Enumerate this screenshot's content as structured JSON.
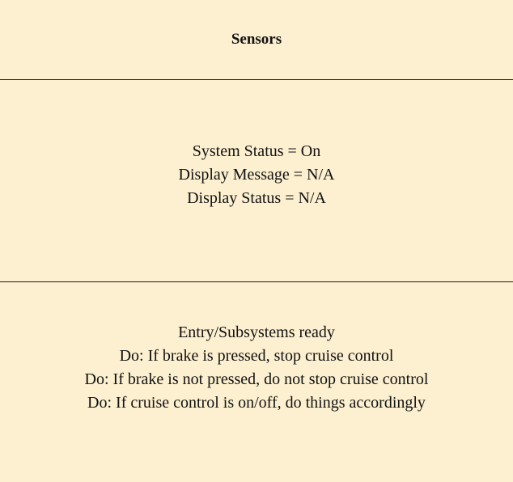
{
  "state": {
    "name": "Sensors",
    "attributes": [
      "System Status = On",
      "Display Message = N/A",
      "Display Status = N/A"
    ],
    "activities": [
      "Entry/Subsystems ready",
      "Do: If brake is pressed, stop cruise control",
      "Do: If brake is not pressed, do not stop cruise control",
      "Do: If cruise control is on/off, do things accordingly"
    ]
  },
  "colors": {
    "fill": "#fdf0d0",
    "stroke": "#1a1a1a",
    "text": "#111111"
  }
}
